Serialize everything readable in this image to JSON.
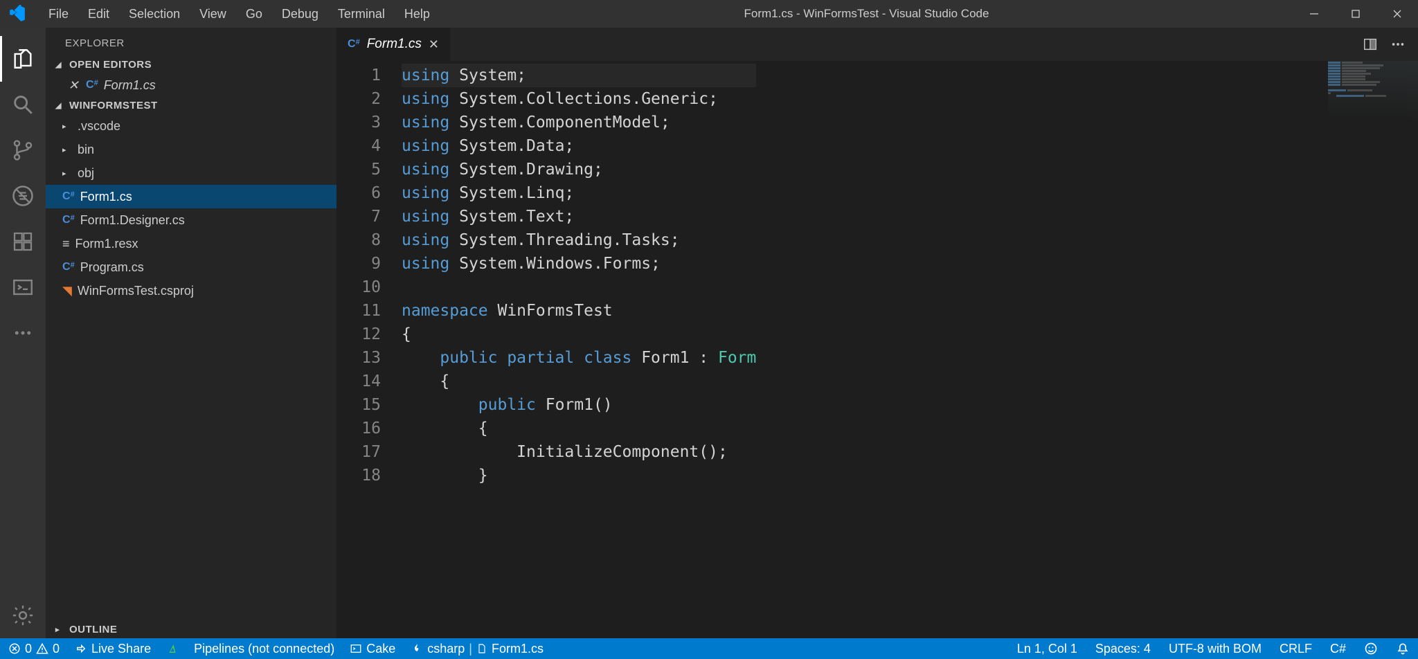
{
  "title": "Form1.cs - WinFormsTest - Visual Studio Code",
  "menu": [
    "File",
    "Edit",
    "Selection",
    "View",
    "Go",
    "Debug",
    "Terminal",
    "Help"
  ],
  "sidebar": {
    "title": "EXPLORER",
    "sections": {
      "open_editors": "OPEN EDITORS",
      "project": "WINFORMSTEST",
      "outline": "OUTLINE"
    },
    "open_editor_file": "Form1.cs",
    "tree": [
      {
        "kind": "folder",
        "name": ".vscode"
      },
      {
        "kind": "folder",
        "name": "bin"
      },
      {
        "kind": "folder",
        "name": "obj"
      },
      {
        "kind": "cs",
        "name": "Form1.cs",
        "active": true
      },
      {
        "kind": "cs",
        "name": "Form1.Designer.cs"
      },
      {
        "kind": "resx",
        "name": "Form1.resx"
      },
      {
        "kind": "cs",
        "name": "Program.cs"
      },
      {
        "kind": "csproj",
        "name": "WinFormsTest.csproj"
      }
    ]
  },
  "tab": {
    "name": "Form1.cs"
  },
  "code": {
    "lines": [
      [
        {
          "t": "using ",
          "c": "kw"
        },
        {
          "t": "System;",
          "c": "pl"
        }
      ],
      [
        {
          "t": "using ",
          "c": "kw"
        },
        {
          "t": "System.Collections.Generic;",
          "c": "pl"
        }
      ],
      [
        {
          "t": "using ",
          "c": "kw"
        },
        {
          "t": "System.ComponentModel;",
          "c": "pl"
        }
      ],
      [
        {
          "t": "using ",
          "c": "kw"
        },
        {
          "t": "System.Data;",
          "c": "pl"
        }
      ],
      [
        {
          "t": "using ",
          "c": "kw"
        },
        {
          "t": "System.Drawing;",
          "c": "pl"
        }
      ],
      [
        {
          "t": "using ",
          "c": "kw"
        },
        {
          "t": "System.Linq;",
          "c": "pl"
        }
      ],
      [
        {
          "t": "using ",
          "c": "kw"
        },
        {
          "t": "System.Text;",
          "c": "pl"
        }
      ],
      [
        {
          "t": "using ",
          "c": "kw"
        },
        {
          "t": "System.Threading.Tasks;",
          "c": "pl"
        }
      ],
      [
        {
          "t": "using ",
          "c": "kw"
        },
        {
          "t": "System.Windows.Forms;",
          "c": "pl"
        }
      ],
      [],
      [
        {
          "t": "namespace ",
          "c": "kw"
        },
        {
          "t": "WinFormsTest",
          "c": "pl"
        }
      ],
      [
        {
          "t": "{",
          "c": "pl"
        }
      ],
      [
        {
          "t": "    ",
          "c": "pl"
        },
        {
          "t": "public partial class ",
          "c": "kw"
        },
        {
          "t": "Form1",
          "c": "pl"
        },
        {
          "t": " : ",
          "c": "pl"
        },
        {
          "t": "Form",
          "c": "cls"
        }
      ],
      [
        {
          "t": "    {",
          "c": "pl"
        }
      ],
      [
        {
          "t": "        ",
          "c": "pl"
        },
        {
          "t": "public ",
          "c": "kw"
        },
        {
          "t": "Form1()",
          "c": "pl"
        }
      ],
      [
        {
          "t": "        {",
          "c": "pl"
        }
      ],
      [
        {
          "t": "            InitializeComponent();",
          "c": "pl"
        }
      ],
      [
        {
          "t": "        }",
          "c": "pl"
        }
      ]
    ]
  },
  "status": {
    "errors": "0",
    "warnings": "0",
    "live_share": "Live Share",
    "pipelines": "Pipelines (not connected)",
    "cake": "Cake",
    "csharp": "csharp",
    "activefile": "Form1.cs",
    "ln": "Ln 1, Col 1",
    "spaces": "Spaces: 4",
    "encoding": "UTF-8 with BOM",
    "eol": "CRLF",
    "lang": "C#"
  }
}
